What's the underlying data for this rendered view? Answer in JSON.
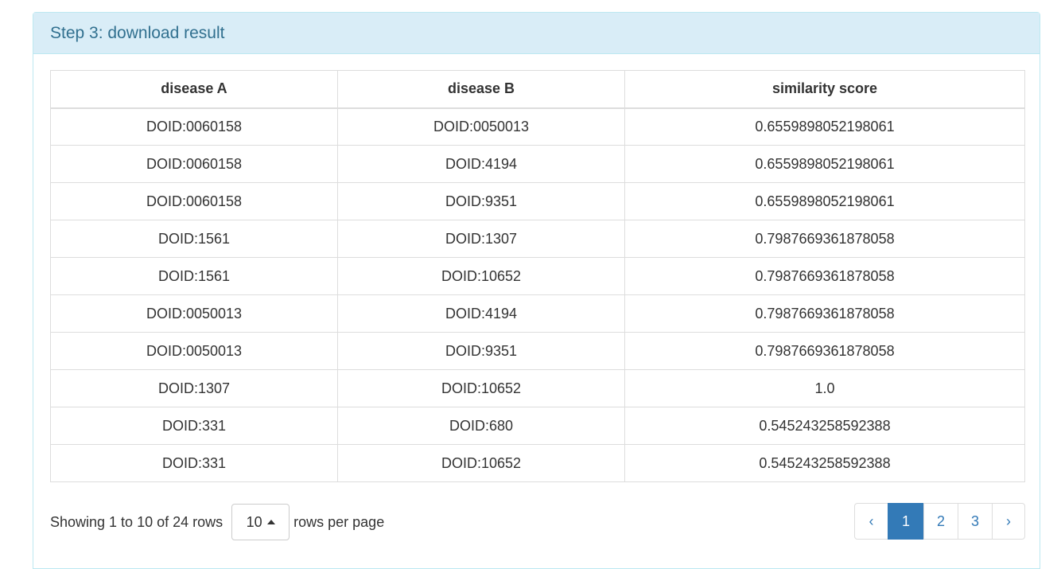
{
  "panel": {
    "title": "Step 3: download result"
  },
  "table": {
    "headers": [
      "disease A",
      "disease B",
      "similarity score"
    ],
    "rows": [
      [
        "DOID:0060158",
        "DOID:0050013",
        "0.6559898052198061"
      ],
      [
        "DOID:0060158",
        "DOID:4194",
        "0.6559898052198061"
      ],
      [
        "DOID:0060158",
        "DOID:9351",
        "0.6559898052198061"
      ],
      [
        "DOID:1561",
        "DOID:1307",
        "0.7987669361878058"
      ],
      [
        "DOID:1561",
        "DOID:10652",
        "0.7987669361878058"
      ],
      [
        "DOID:0050013",
        "DOID:4194",
        "0.7987669361878058"
      ],
      [
        "DOID:0050013",
        "DOID:9351",
        "0.7987669361878058"
      ],
      [
        "DOID:1307",
        "DOID:10652",
        "1.0"
      ],
      [
        "DOID:331",
        "DOID:680",
        "0.545243258592388"
      ],
      [
        "DOID:331",
        "DOID:10652",
        "0.545243258592388"
      ]
    ]
  },
  "footer": {
    "showing": "Showing 1 to 10 of 24 rows",
    "page_size": "10",
    "rows_per_page": "rows per page"
  },
  "pagination": {
    "prev": "‹",
    "pages": [
      "1",
      "2",
      "3"
    ],
    "active": "1",
    "next": "›"
  },
  "colors": {
    "heading_bg": "#d9edf7",
    "heading_text": "#31708f",
    "active_page": "#337ab7"
  }
}
